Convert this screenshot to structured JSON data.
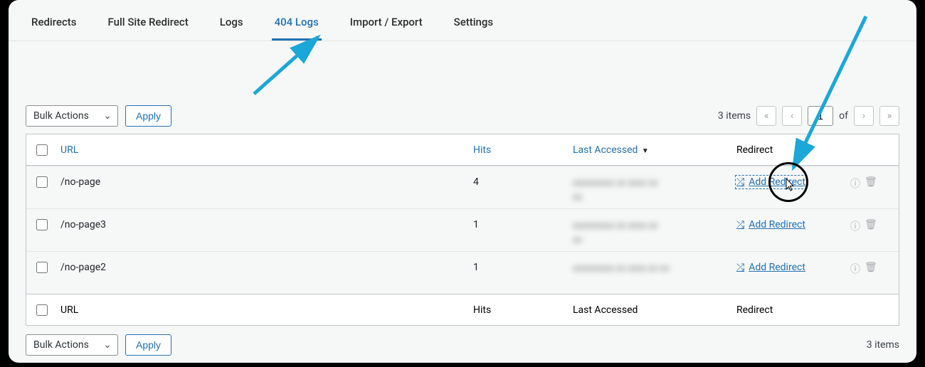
{
  "tabs": [
    "Redirects",
    "Full Site Redirect",
    "Logs",
    "404 Logs",
    "Import / Export",
    "Settings"
  ],
  "active_tab": "404 Logs",
  "bulk": {
    "label": "Bulk Actions",
    "apply": "Apply"
  },
  "pager": {
    "items_text": "3 items",
    "page": "1",
    "of_text": "of"
  },
  "columns": {
    "url": "URL",
    "hits": "Hits",
    "last": "Last Accessed",
    "redirect": "Redirect"
  },
  "rows": [
    {
      "url": "/no-page",
      "hits": "4",
      "redirect_label": "Add Redirect"
    },
    {
      "url": "/no-page3",
      "hits": "1",
      "redirect_label": "Add Redirect"
    },
    {
      "url": "/no-page2",
      "hits": "1",
      "redirect_label": "Add Redirect"
    }
  ],
  "footer_items_text": "3 items"
}
